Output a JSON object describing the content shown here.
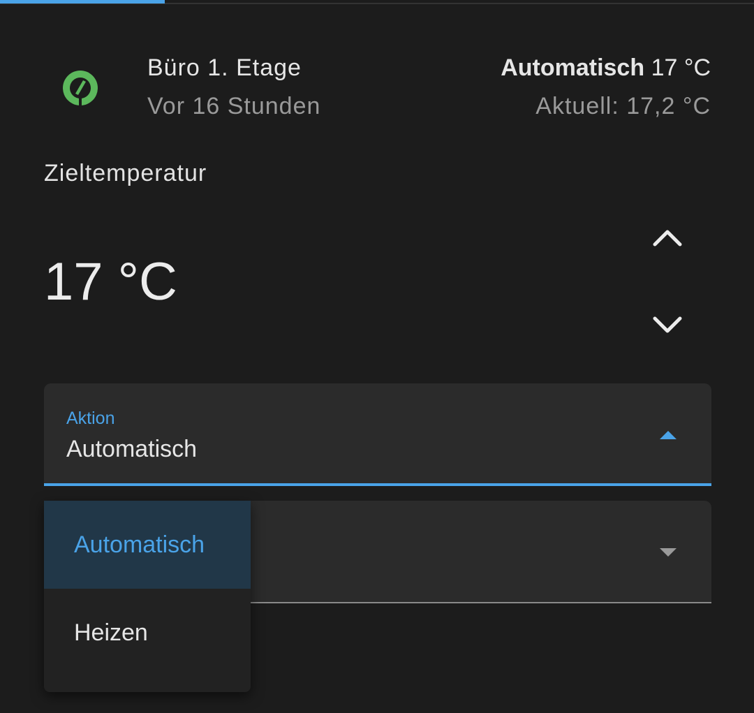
{
  "header": {
    "name": "Büro 1. Etage",
    "last_changed": "Vor 16 Stunden",
    "mode": "Automatisch",
    "target": "17 °C",
    "current": "Aktuell: 17,2 °C"
  },
  "target_temperature": {
    "label": "Zieltemperatur",
    "value": "17 °C"
  },
  "action_select": {
    "label": "Aktion",
    "value": "Automatisch"
  },
  "menu": {
    "items": [
      "Automatisch",
      "Heizen"
    ],
    "selected": "Automatisch"
  },
  "colors": {
    "accent": "#4aa3e8",
    "icon": "#5cb85c",
    "background": "#1c1c1c"
  },
  "icons": {
    "entity": "thermostat-dial-icon",
    "increase": "chevron-up-icon",
    "decrease": "chevron-down-icon",
    "dropdown_open": "caret-up-icon",
    "dropdown_closed": "caret-down-icon"
  }
}
